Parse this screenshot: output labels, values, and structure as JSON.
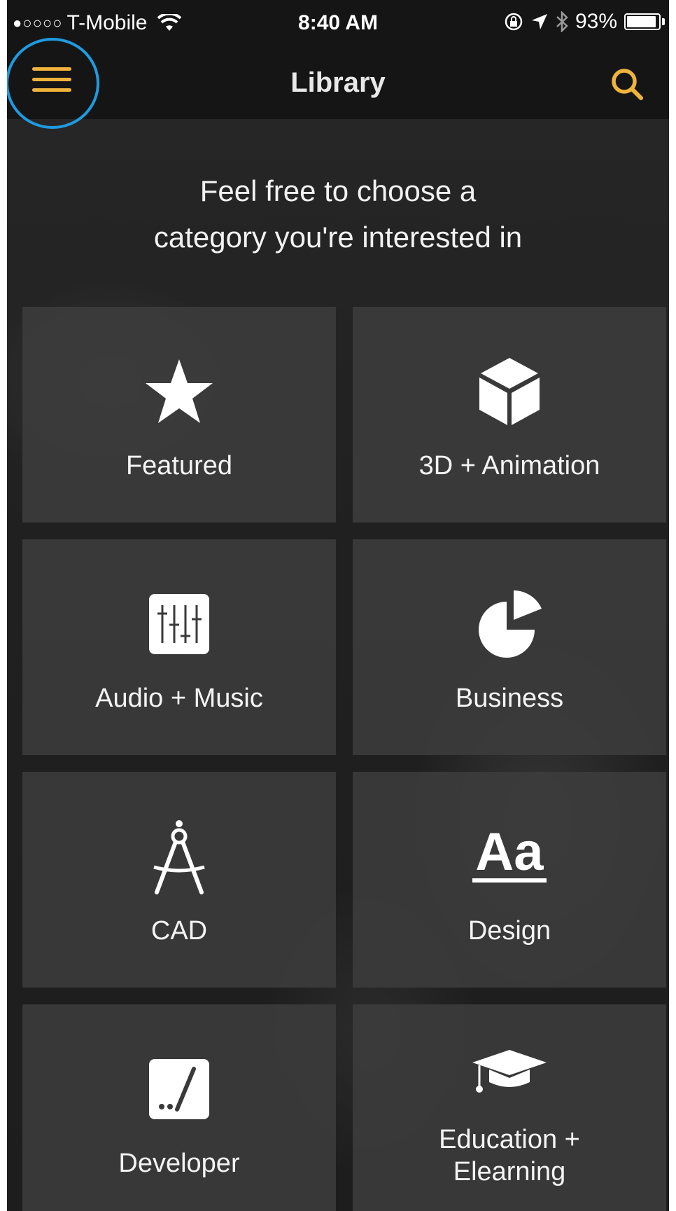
{
  "status_bar": {
    "signal": "●○○○○",
    "carrier": "T-Mobile",
    "time": "8:40 AM",
    "battery_percent": "93%",
    "battery_level": 0.93
  },
  "nav": {
    "title": "Library"
  },
  "headline": {
    "line1": "Feel free to choose a",
    "line2": "category you're interested in"
  },
  "categories": [
    {
      "label": "Featured",
      "icon": "star-icon"
    },
    {
      "label": "3D + Animation",
      "icon": "cube-icon"
    },
    {
      "label": "Audio + Music",
      "icon": "mixer-sliders-icon"
    },
    {
      "label": "Business",
      "icon": "pie-chart-icon"
    },
    {
      "label": "CAD",
      "icon": "drafting-compass-icon"
    },
    {
      "label": "Design",
      "icon": "typography-aa-icon"
    },
    {
      "label": "Developer",
      "icon": "terminal-icon"
    },
    {
      "label_line1": "Education +",
      "label_line2": "Elearning",
      "icon": "graduation-cap-icon"
    }
  ],
  "colors": {
    "accent": "#f0b43c",
    "highlight_ring": "#1f9be0",
    "tile_bg": "#3c3c3c",
    "bar_bg": "#151515"
  }
}
